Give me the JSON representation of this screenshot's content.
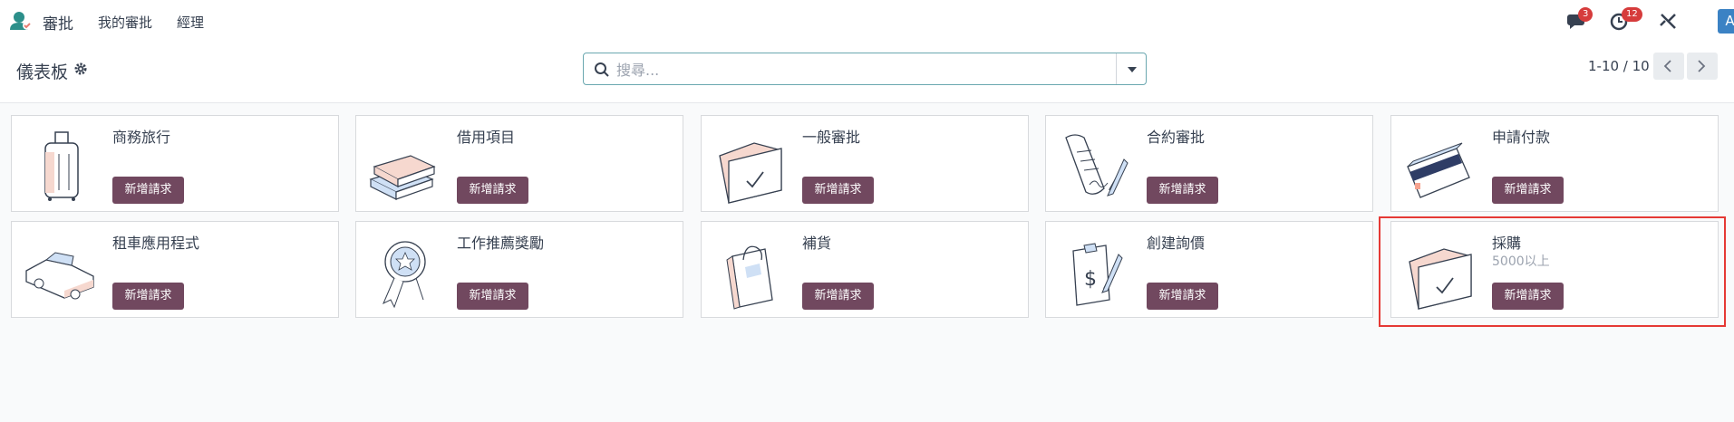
{
  "nav": {
    "app": "審批",
    "items": [
      "我的審批",
      "經理"
    ],
    "messages_badge": "3",
    "activities_badge": "12",
    "avatar": "A",
    "icons": [
      "approvals-logo-icon",
      "chat-icon",
      "clock-icon",
      "tools-icon"
    ]
  },
  "control": {
    "breadcrumb": "儀表板",
    "search_placeholder": "搜尋...",
    "pager": "1-10 / 10"
  },
  "cards": [
    {
      "title": "商務旅行",
      "subtitle": "",
      "button": "新增請求",
      "icon": "luggage-icon"
    },
    {
      "title": "借用項目",
      "subtitle": "",
      "button": "新增請求",
      "icon": "books-icon"
    },
    {
      "title": "一般審批",
      "subtitle": "",
      "button": "新增請求",
      "icon": "folder-check-icon"
    },
    {
      "title": "合約審批",
      "subtitle": "",
      "button": "新增請求",
      "icon": "contract-icon"
    },
    {
      "title": "申請付款",
      "subtitle": "",
      "button": "新增請求",
      "icon": "credit-card-icon"
    },
    {
      "title": "租車應用程式",
      "subtitle": "",
      "button": "新增請求",
      "icon": "car-icon"
    },
    {
      "title": "工作推薦獎勵",
      "subtitle": "",
      "button": "新增請求",
      "icon": "award-icon"
    },
    {
      "title": "補貨",
      "subtitle": "",
      "button": "新增請求",
      "icon": "shopping-bag-icon"
    },
    {
      "title": "創建詢價",
      "subtitle": "",
      "button": "新增請求",
      "icon": "clipboard-dollar-icon"
    },
    {
      "title": "採購",
      "subtitle": "5000以上",
      "button": "新增請求",
      "icon": "folder-check-icon"
    }
  ],
  "colors": {
    "primary_button": "#71485f",
    "badge": "#d63c3c",
    "avatar": "#3b82c4",
    "highlight": "#e53935"
  }
}
